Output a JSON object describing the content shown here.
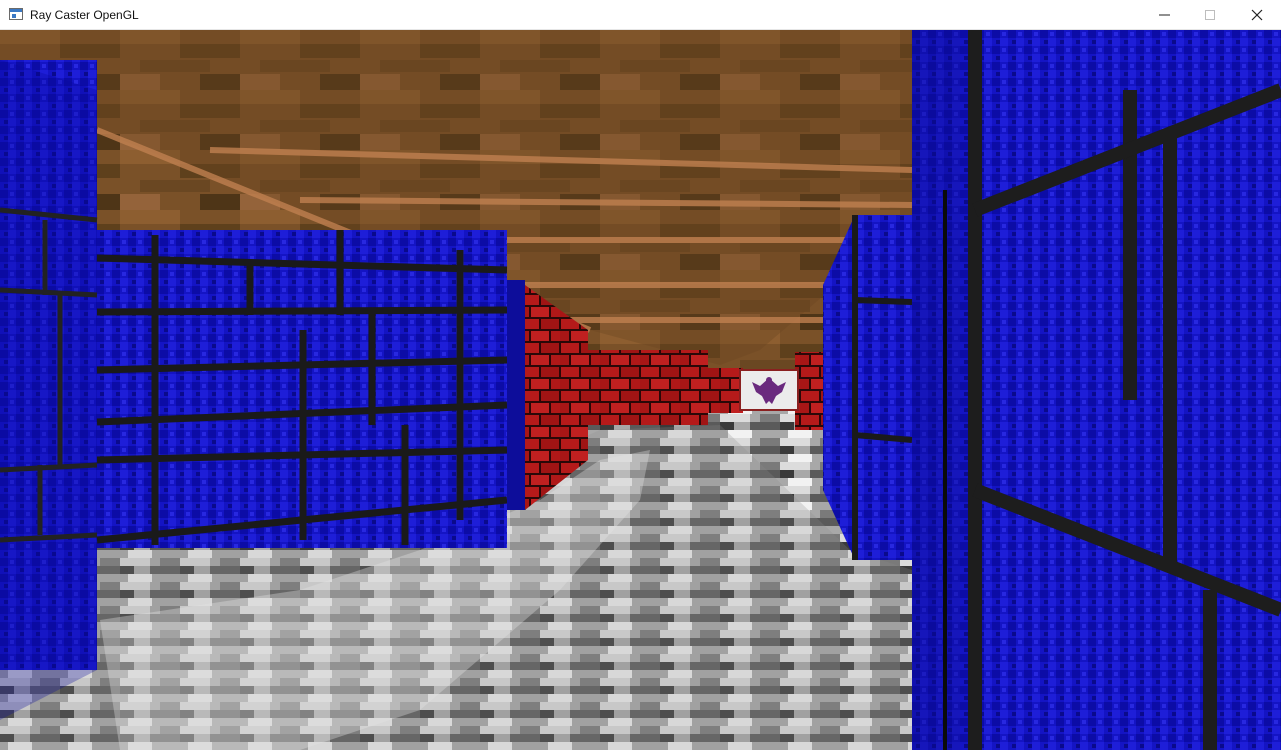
{
  "window": {
    "title": "Ray Caster OpenGL",
    "icons": {
      "app": "window-app-icon",
      "minimize": "minimize-icon",
      "maximize": "maximize-icon",
      "close": "close-icon"
    }
  },
  "scene": {
    "colors": {
      "ceiling": "#6e4a22",
      "ceiling_beam": "#b87a47",
      "floor_light": "#d8d8d8",
      "floor_dark": "#3a3a3a",
      "wall_blue": "#1010c8",
      "wall_brick": "#b01818",
      "mortar": "#1c1c1c",
      "banner": "#e8e8e8",
      "eagle": "#7a2a8a"
    }
  }
}
